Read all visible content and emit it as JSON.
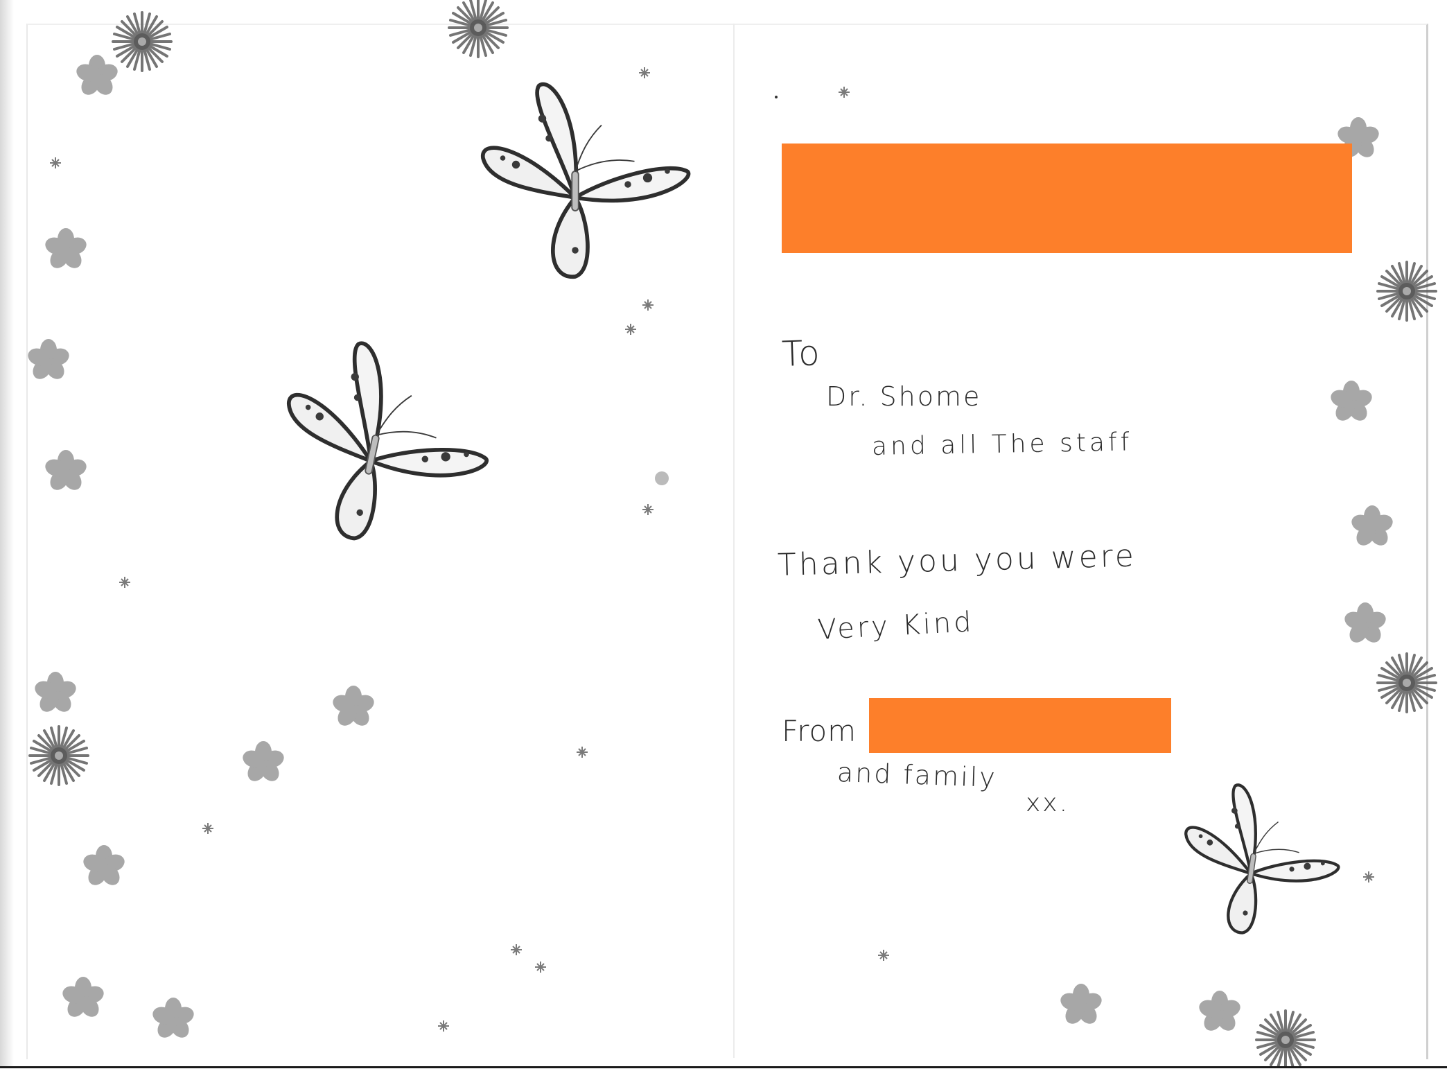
{
  "card": {
    "handwriting": {
      "to": "To",
      "recipient": "Dr. Shome",
      "recipient_line2": "and all The staff",
      "thanks": "Thank you you were",
      "thanks_line2": "Very Kind",
      "from": "From",
      "family": "and family",
      "kisses": "xx."
    }
  },
  "colors": {
    "redaction": "#fd7f2a",
    "flower": "#6e6e6e",
    "butterfly_outline": "#2e2e2e"
  },
  "icons": {
    "butterflies": [
      "butterfly-icon",
      "butterfly-icon",
      "butterfly-icon"
    ],
    "flowers": [
      "daisy-icon",
      "blossom-icon",
      "sparkle-icon"
    ]
  }
}
